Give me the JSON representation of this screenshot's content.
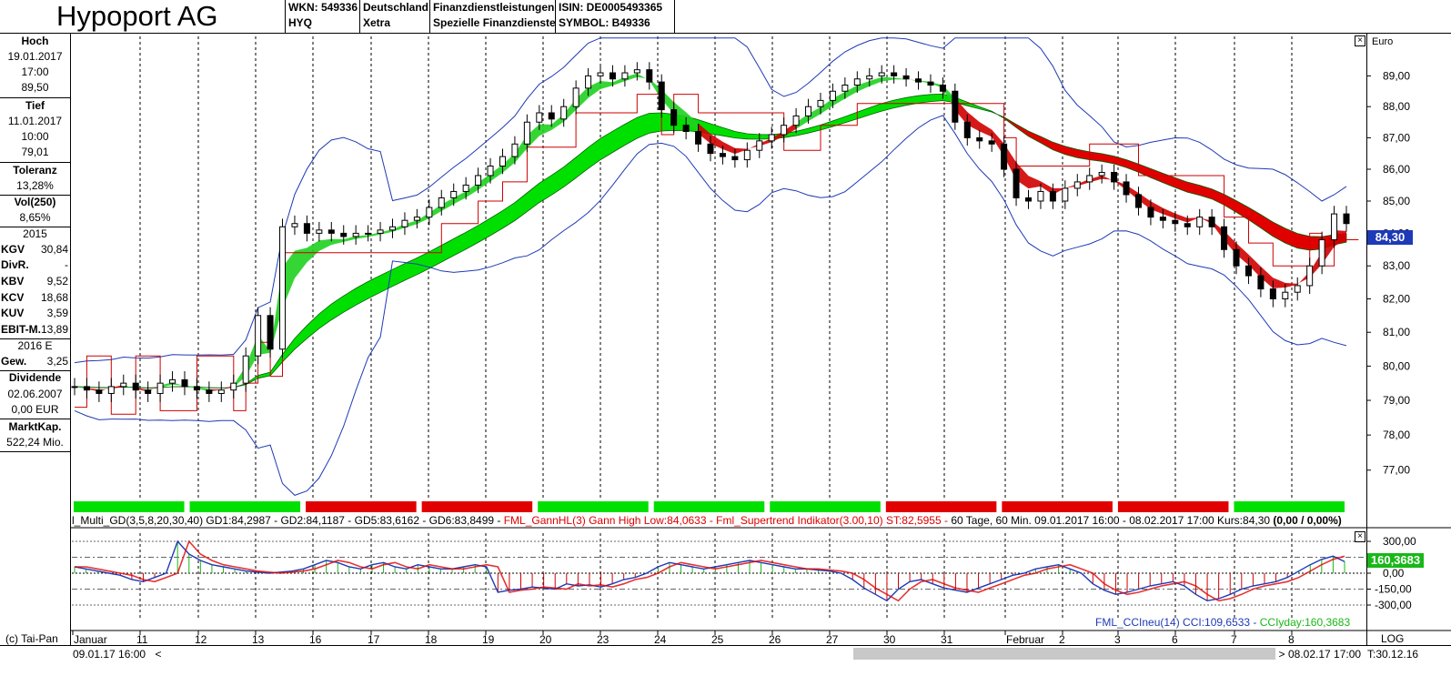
{
  "header": {
    "title": "Hypoport AG",
    "wkn": "WKN: 549336",
    "ticker": "HYQ",
    "exchange": "Deutschland",
    "venue": "Xetra",
    "sector": "Finanzdienstleistungen",
    "subsector": "Spezielle Finanzdienste",
    "isin": "ISIN: DE0005493365",
    "symbol": "SYMBOL: B49336"
  },
  "left_panel": {
    "hoch_label": "Hoch",
    "hoch_date": "19.01.2017",
    "hoch_time": "17:00",
    "hoch_value": "89,50",
    "tief_label": "Tief",
    "tief_date": "11.01.2017",
    "tief_time": "10:00",
    "tief_value": "79,01",
    "toleranz_label": "Toleranz",
    "toleranz_value": "13,28%",
    "vol_label": "Vol(250)",
    "vol_value": "8,65%",
    "year_2015": "2015",
    "kgv_label": "KGV",
    "kgv_value": "30,84",
    "divr_label": "DivR.",
    "divr_value": "-",
    "kbv_label": "KBV",
    "kbv_value": "9,52",
    "kcv_label": "KCV",
    "kcv_value": "18,68",
    "kuv_label": "KUV",
    "kuv_value": "3,59",
    "ebit_label": "EBIT-M.",
    "ebit_value": "13,89",
    "year_2016": "2016 E",
    "gew_label": "Gew.",
    "gew_value": "3,25",
    "dividende_label": "Dividende",
    "dividende_date": "02.06.2007",
    "dividende_value": "0,00 EUR",
    "marktkap_label": "MarktKap.",
    "marktkap_value": "522,24 Mio."
  },
  "info_bar": {
    "part1": "l_Multi_GD(3,5,8,20,30,40) GD1:84,2987 - GD2:84,1187 - GD5:83,6162 - GD6:83,8499 - ",
    "part2": "FML_GannHL(3) Gann High Low:84,0633 - Fml_Supertrend Indikator(3.00,10) ST:82,5955 - ",
    "part3": "60 Tage, 60 Min. 09.01.2017 16:00 - 08.02.2017 17:00  Kurs:84,30 ",
    "part4": "(0,00 / 0,00%)"
  },
  "cci_legend": {
    "text1": "FML_CCIneu(14) CCI:109,6533 - ",
    "text2": "CCIyday:160,3683"
  },
  "bottom": {
    "copyright": "(c) Tai-Pan",
    "start_date": "09.01.17 16:00",
    "end_date": "08.02.17 17:00",
    "scale": "LOG",
    "time_label": "T:30.12.16",
    "scroll_left": "<",
    "scroll_right": ">"
  },
  "chart_data": [
    {
      "type": "line",
      "subtype": "candlestick",
      "currency_label": "Euro",
      "y_ticks": [
        "77,00",
        "78,00",
        "79,00",
        "80,00",
        "81,00",
        "82,00",
        "83,00",
        "84,00",
        "85,00",
        "86,00",
        "87,00",
        "88,00",
        "89,00"
      ],
      "y_range": [
        76.2,
        90.3
      ],
      "y_scale": "log",
      "last_price_label": "84,30",
      "x_labels": [
        "Januar",
        "11",
        "12",
        "13",
        "16",
        "17",
        "18",
        "19",
        "20",
        "23",
        "24",
        "25",
        "26",
        "27",
        "30",
        "31",
        "Februar",
        "2",
        "3",
        "6",
        "7",
        "8"
      ],
      "close_series": [
        79.4,
        79.3,
        79.2,
        79.4,
        79.5,
        79.3,
        79.2,
        79.5,
        79.6,
        79.4,
        79.3,
        79.2,
        79.3,
        79.5,
        80.3,
        81.5,
        80.5,
        84.2,
        84.3,
        84.0,
        84.1,
        84.0,
        83.9,
        84.0,
        84.0,
        84.1,
        84.2,
        84.4,
        84.5,
        84.8,
        85.1,
        85.3,
        85.5,
        85.8,
        86.1,
        86.4,
        86.8,
        87.5,
        87.8,
        87.6,
        88.0,
        88.6,
        89.0,
        89.1,
        88.9,
        89.1,
        89.2,
        88.8,
        87.9,
        87.4,
        87.2,
        86.8,
        86.5,
        86.4,
        86.3,
        86.6,
        86.9,
        87.1,
        87.4,
        87.7,
        88.0,
        88.2,
        88.5,
        88.7,
        88.9,
        89.0,
        89.1,
        89.0,
        88.9,
        88.8,
        88.7,
        88.5,
        87.5,
        87.0,
        86.9,
        86.8,
        86.0,
        85.1,
        85.0,
        85.3,
        85.0,
        85.4,
        85.6,
        85.8,
        85.9,
        85.6,
        85.2,
        84.8,
        84.5,
        84.4,
        84.3,
        84.2,
        84.5,
        84.2,
        83.5,
        83.0,
        82.7,
        82.3,
        82.0,
        82.2,
        82.4,
        83.0,
        83.8,
        84.6,
        84.3
      ],
      "ma_green_band": [
        [
          78.4,
          78.6
        ],
        [
          78.9,
          79.1
        ],
        [
          83.0,
          83.6
        ],
        [
          86.6,
          87.3
        ],
        [
          87.2,
          87.3
        ],
        [
          88.0,
          88.3
        ],
        [
          88.4,
          88.5
        ],
        [
          87.9,
          88.0
        ]
      ],
      "ma_red_band": [
        [
          87.6,
          87.8
        ],
        [
          86.0,
          86.3
        ],
        [
          85.2,
          85.5
        ],
        [
          83.7,
          84.0
        ]
      ],
      "trend_bar": [
        "green",
        "green",
        "red",
        "red",
        "green",
        "green",
        "green",
        "red",
        "red",
        "red",
        "green"
      ]
    },
    {
      "type": "line",
      "name": "FML_CCIneu(14)",
      "y_ticks": [
        "300,00",
        "150,00",
        "0,00",
        "-150,00",
        "-300,00"
      ],
      "y_range": [
        -360,
        360
      ],
      "cci_value_label": "160,3683",
      "values": [
        60,
        40,
        20,
        0,
        -20,
        -60,
        -80,
        -40,
        0,
        300,
        180,
        120,
        80,
        60,
        40,
        20,
        10,
        0,
        10,
        20,
        40,
        80,
        120,
        100,
        60,
        40,
        80,
        100,
        60,
        40,
        80,
        60,
        40,
        40,
        60,
        80,
        60,
        -180,
        -160,
        -150,
        -130,
        -140,
        -150,
        -100,
        -120,
        -110,
        -130,
        -100,
        -60,
        -40,
        0,
        60,
        100,
        80,
        60,
        40,
        60,
        80,
        100,
        120,
        100,
        80,
        60,
        40,
        40,
        30,
        20,
        0,
        -60,
        -140,
        -200,
        -260,
        -150,
        -80,
        -60,
        -100,
        -140,
        -160,
        -180,
        -140,
        -100,
        -60,
        -20,
        0,
        40,
        60,
        80,
        40,
        0,
        -100,
        -160,
        -200,
        -180,
        -150,
        -120,
        -100,
        -80,
        -120,
        -200,
        -260,
        -240,
        -200,
        -150,
        -120,
        -100,
        -80,
        -40,
        20,
        80,
        130,
        160,
        110
      ]
    }
  ]
}
